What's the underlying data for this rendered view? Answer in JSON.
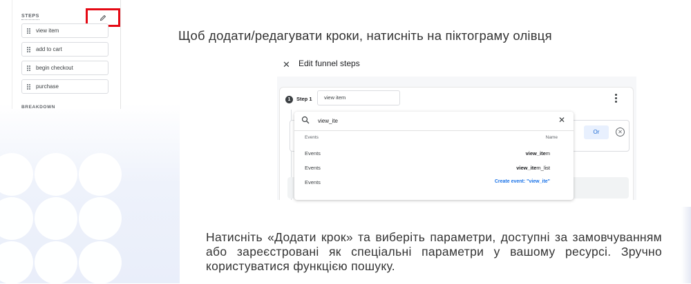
{
  "steps_panel": {
    "title": "STEPS",
    "edit_icon": "pencil-icon",
    "steps": [
      "view item",
      "add to cart",
      "begin checkout",
      "purchase"
    ],
    "breakdown_label": "BREAKDOWN",
    "highlight_color": "#e50914"
  },
  "instruction_top": "Щоб додати/редагувати кроки, натисніть на піктограму олівця",
  "dialog": {
    "close_icon": "close-icon",
    "title": "Edit funnel steps",
    "step_number": "1",
    "step_label": "Step 1",
    "step_name_value": "view item",
    "or_button": "Or",
    "search": {
      "query": "view_ite",
      "col_category": "Events",
      "col_name": "Name",
      "rows": [
        {
          "category": "Events",
          "match": "view_ite",
          "rest": "m"
        },
        {
          "category": "Events",
          "match": "view_ite",
          "rest": "m_list"
        }
      ],
      "create_row": {
        "category": "Events",
        "label": "Create event: \"view_ite\""
      }
    }
  },
  "instruction_bottom": "Натисніть «Додати крок» та виберіть параметри, доступні за замовчуванням або зареєстровані як спеціальні параметри у вашому ресурсі. Зручно користуватися функцією пошуку."
}
